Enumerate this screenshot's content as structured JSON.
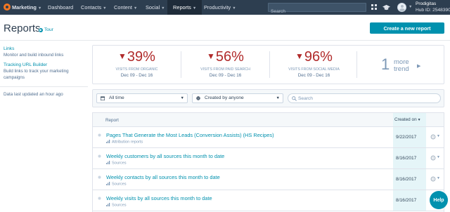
{
  "topnav": {
    "brand": "Marketing",
    "items": [
      {
        "label": "Dashboard"
      },
      {
        "label": "Contacts"
      },
      {
        "label": "Content"
      },
      {
        "label": "Social"
      },
      {
        "label": "Reports",
        "active": true
      },
      {
        "label": "Productivity"
      }
    ],
    "search_placeholder": "Search",
    "account_name": "Prodigitas",
    "hub_id": "Hub ID: 2548390"
  },
  "header": {
    "title": "Reports",
    "tour_label": "Tour",
    "create_label": "Create a new report"
  },
  "sidebar": {
    "links_title": "Links",
    "links_desc": "Monitor and build inbound links",
    "tracking_title": "Tracking URL Builder",
    "tracking_desc": "Build links to track your marketing campaigns",
    "updated": "Data last updated an hour ago"
  },
  "stats": [
    {
      "value": "39%",
      "label": "VISITS FROM ORGANIC",
      "dates": "Dec 09 - Dec 16",
      "direction": "down"
    },
    {
      "value": "56%",
      "label": "VISITS FROM PAID SEARCH",
      "dates": "Dec 09 - Dec 16",
      "direction": "down"
    },
    {
      "value": "96%",
      "label": "VISITS FROM SOCIAL MEDIA",
      "dates": "Dec 09 - Dec 16",
      "direction": "down"
    }
  ],
  "trend": {
    "count": "1",
    "more": "more",
    "word": "trend"
  },
  "filters": {
    "time": "All time",
    "creator": "Created by anyone",
    "search_placeholder": "Search"
  },
  "table": {
    "col_report": "Report",
    "col_created": "Created on",
    "rows": [
      {
        "title": "Pages That Generate the Most Leads (Conversion Assists) (HS Recipes)",
        "type": "Attribution reports",
        "date": "9/22/2017"
      },
      {
        "title": "Weekly customers by all sources this month to date",
        "type": "Sources",
        "date": "8/16/2017"
      },
      {
        "title": "Weekly contacts by all sources this month to date",
        "type": "Sources",
        "date": "8/16/2017"
      },
      {
        "title": "Weekly visits by all sources this month to date",
        "type": "Sources",
        "date": "8/16/2017"
      }
    ]
  },
  "help_label": "Help",
  "colors": {
    "nav_bg": "#2d3e50",
    "accent": "#0091ae",
    "negative": "#b02a2a",
    "brand_orange": "#f57722"
  }
}
